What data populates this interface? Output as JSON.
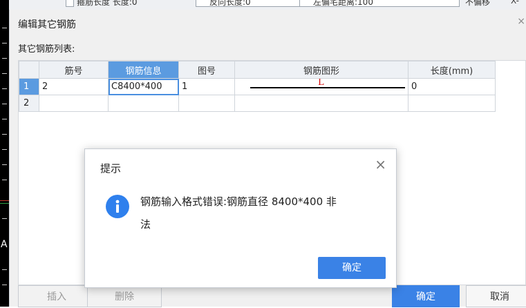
{
  "background": {
    "toolbar_segments": [
      "箍筋长度 长度:0",
      "反向长度:0",
      "左偏宅距离:100",
      "不偏移",
      "X-"
    ],
    "side_letter": "A"
  },
  "dialog": {
    "title": "编辑其它钢筋",
    "close_glyph": "×",
    "list_label": "其它钢筋列表:",
    "columns": [
      "筋号",
      "钢筋信息",
      "图号",
      "钢筋图形",
      "长度(mm)"
    ],
    "rows": [
      {
        "index": "1",
        "bar_no": "2",
        "bar_info": "C8400*400",
        "fig_no": "1",
        "shape_letter": "L",
        "length": "0"
      },
      {
        "index": "2",
        "bar_no": "",
        "bar_info": "",
        "fig_no": "",
        "shape_letter": "",
        "length": ""
      }
    ],
    "buttons": {
      "insert": "插入",
      "delete": "删除",
      "ok": "确定",
      "cancel": "取消"
    }
  },
  "message_box": {
    "title": "提示",
    "close_glyph": "×",
    "icon": "info-icon",
    "line1": "钢筋输入格式错误:钢筋直径 8400*400 非",
    "line2": "法",
    "ok": "确定"
  },
  "colors": {
    "accent": "#3a82e6",
    "header_active": "#5b9be0",
    "shape_letter": "#d40000"
  }
}
